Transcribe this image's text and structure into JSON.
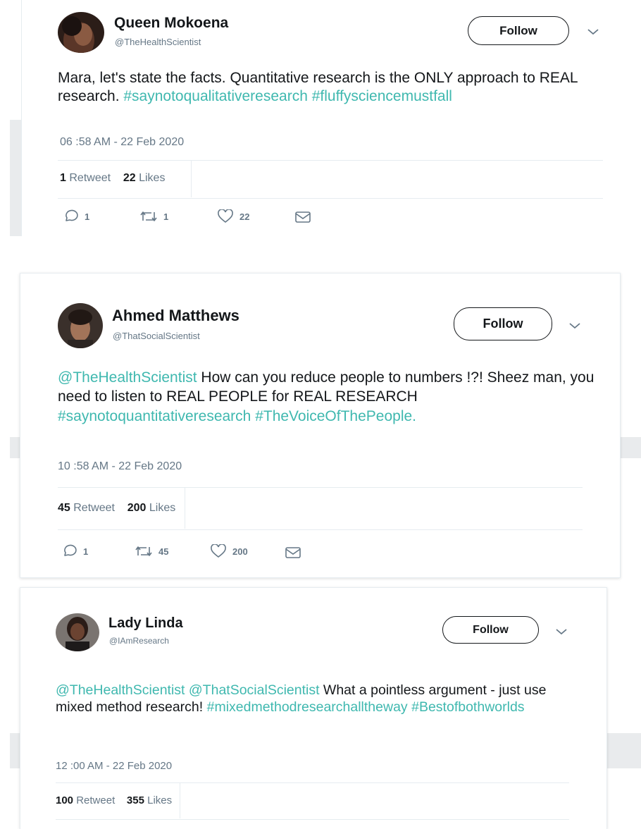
{
  "tweets": [
    {
      "name": "Queen Mokoena",
      "handle": "@TheHealthScientist",
      "follow_label": "Follow",
      "text_plain_1": "Mara, let's state the facts. Quantitative research is the ONLY approach to REAL research. ",
      "tag_1": "#saynotoqualitativeresearch",
      "text_plain_2": " ",
      "tag_2": "#fluffysciencemustfall",
      "timestamp": "06 :58 AM - 22 Feb 2020",
      "retweet_count": "1",
      "retweet_label": "Retweet",
      "likes_count": "22",
      "likes_label": "Likes",
      "reply_count": "1",
      "retweet_action_count": "1",
      "like_action_count": "22"
    },
    {
      "name": "Ahmed Matthews",
      "handle": "@ThatSocialScientist",
      "follow_label": "Follow",
      "mention_1": "@TheHealthScientist",
      "text_plain_1": " How can you reduce people to numbers !?! Sheez man, you need to listen to REAL PEOPLE for REAL RESEARCH ",
      "tag_1": "#saynotoquantitativeresearch",
      "text_plain_2": " ",
      "tag_2": "#TheVoiceOfThePeople.",
      "timestamp": "10 :58 AM - 22 Feb 2020",
      "retweet_count": "45",
      "retweet_label": "Retweet",
      "likes_count": "200",
      "likes_label": "Likes",
      "reply_count": "1",
      "retweet_action_count": "45",
      "like_action_count": "200"
    },
    {
      "name": "Lady Linda",
      "handle": "@IAmResearch",
      "follow_label": "Follow",
      "mention_1": "@TheHealthScientist",
      "mention_2": "@ThatSocialScientist",
      "text_plain_1": " What a pointless argument - just use mixed method research! ",
      "tag_1": "#mixedmethodresearchalltheway",
      "text_plain_2": " ",
      "tag_2": "#Bestofbothworlds",
      "timestamp": "12 :00 AM - 22 Feb 2020",
      "retweet_count": "100",
      "retweet_label": "Retweet",
      "likes_count": "355",
      "likes_label": "Likes"
    }
  ],
  "colors": {
    "hashtag": "#3fb8af",
    "secondary_text": "#657786",
    "primary_text": "#14171a",
    "divider": "#e6ecf0"
  },
  "icons": [
    "reply-icon",
    "retweet-icon",
    "like-icon",
    "message-icon",
    "chevron-down-icon"
  ]
}
